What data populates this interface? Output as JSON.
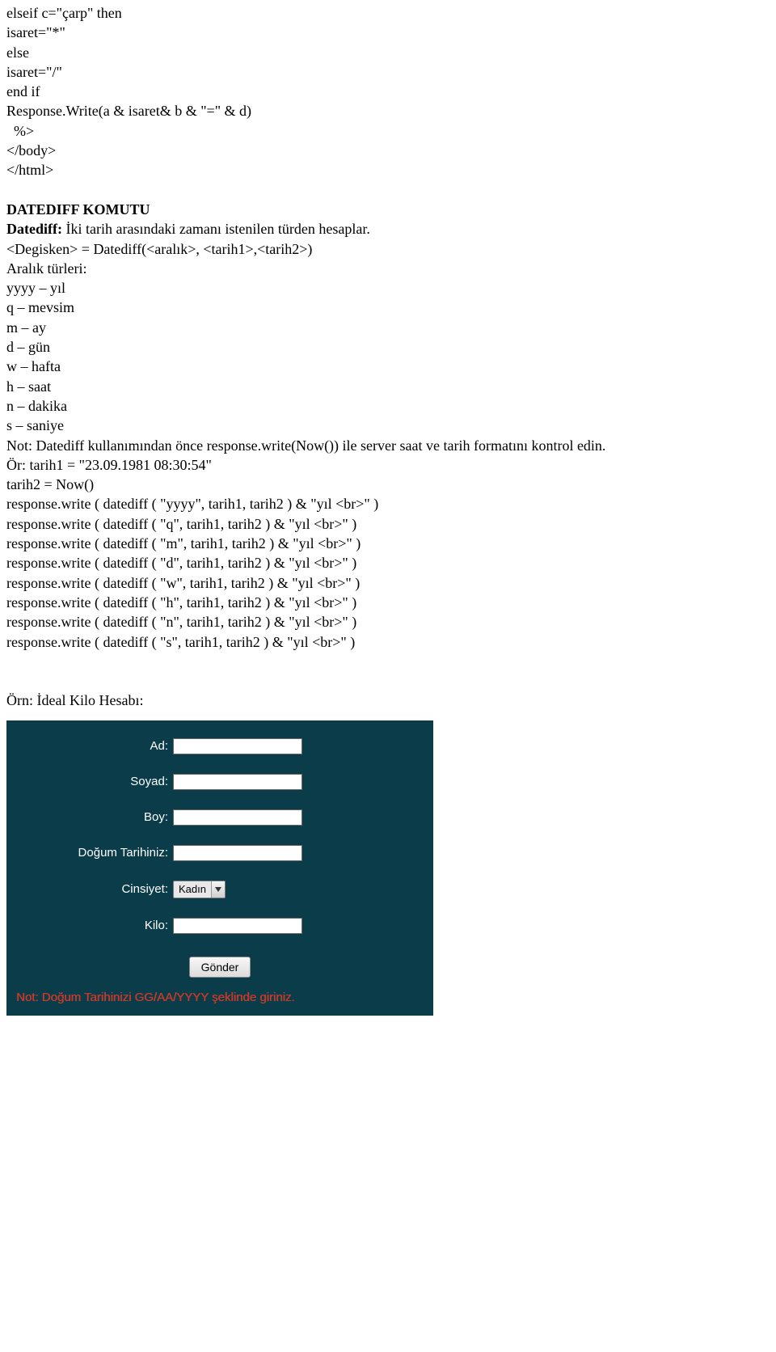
{
  "doc": {
    "lines_top": [
      "elseif c=\"çarp\" then",
      "isaret=\"*\"",
      "else",
      "isaret=\"/\"",
      "end if",
      "Response.Write(a & isaret& b & \"=\" & d)",
      "  %>",
      "</body>",
      "</html>"
    ],
    "heading1": "DATEDIFF KOMUTU",
    "datediff_bold": "Datediff:",
    "datediff_desc": " İki tarih arasındaki zamanı istenilen türden hesaplar.",
    "lines_mid": [
      "<Degisken> = Datediff(<aralık>, <tarih1>,<tarih2>)",
      "Aralık türleri:",
      "yyyy – yıl",
      "q – mevsim",
      "m – ay",
      "d – gün",
      "w – hafta",
      "h – saat",
      "n – dakika",
      "s – saniye",
      "Not: Datediff kullanımından önce response.write(Now()) ile server saat ve tarih formatını kontrol edin.",
      "Ör: tarih1 = \"23.09.1981 08:30:54\"",
      "tarih2 = Now()",
      "response.write ( datediff ( \"yyyy\", tarih1, tarih2 ) & \"yıl <br>\" )",
      "response.write ( datediff ( \"q\", tarih1, tarih2 ) & \"yıl <br>\" )",
      "response.write ( datediff ( \"m\", tarih1, tarih2 ) & \"yıl <br>\" )",
      "response.write ( datediff ( \"d\", tarih1, tarih2 ) & \"yıl <br>\" )",
      "response.write ( datediff ( \"w\", tarih1, tarih2 ) & \"yıl <br>\" )",
      "response.write ( datediff ( \"h\", tarih1, tarih2 ) & \"yıl <br>\" )",
      "response.write ( datediff ( \"n\", tarih1, tarih2 ) & \"yıl <br>\" )",
      "response.write ( datediff ( \"s\", tarih1, tarih2 ) & \"yıl <br>\" )"
    ],
    "example_heading": "Örn: İdeal Kilo Hesabı:"
  },
  "form": {
    "labels": {
      "ad": "Ad:",
      "soyad": "Soyad:",
      "boy": "Boy:",
      "dogum": "Doğum Tarihiniz:",
      "cinsiyet": "Cinsiyet:",
      "kilo": "Kilo:"
    },
    "cinsiyet_value": "Kadın",
    "submit": "Gönder",
    "note": "Not: Doğum Tarihinizi GG/AA/YYYY şeklinde giriniz."
  }
}
